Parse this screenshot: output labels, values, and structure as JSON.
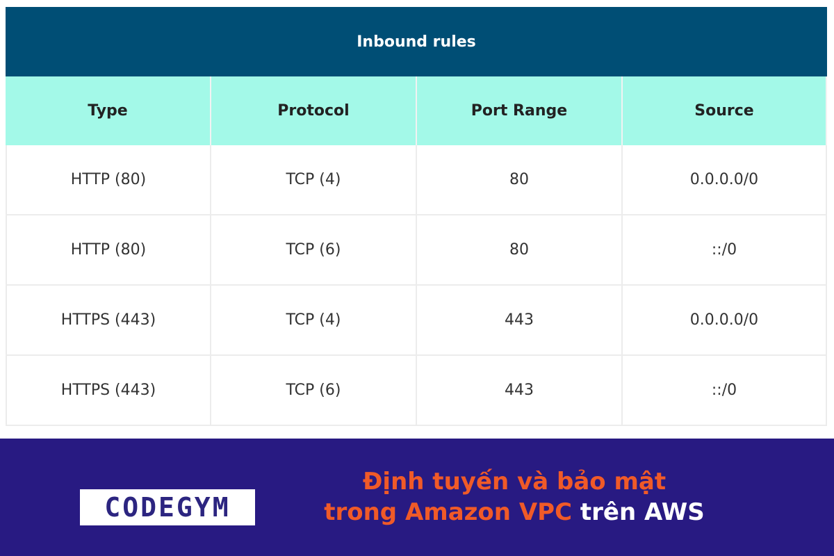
{
  "table": {
    "title": "Inbound rules",
    "columns": [
      "Type",
      "Protocol",
      "Port Range",
      "Source"
    ],
    "rows": [
      [
        "HTTP (80)",
        "TCP (4)",
        "80",
        "0.0.0.0/0"
      ],
      [
        "HTTP (80)",
        "TCP (6)",
        "80",
        "::/0"
      ],
      [
        "HTTPS (443)",
        "TCP (4)",
        "443",
        "0.0.0.0/0"
      ],
      [
        "HTTPS (443)",
        "TCP (6)",
        "443",
        "::/0"
      ]
    ]
  },
  "footer": {
    "logo": "CODEGYM",
    "headline_line1": "Định tuyến và bảo mật",
    "headline_line2_orange": "trong Amazon VPC",
    "headline_line2_white": " trên AWS"
  },
  "colors": {
    "title_bg": "#004e75",
    "header_bg": "#a3f9e8",
    "footer_bg": "#281a82",
    "accent": "#f05a28"
  }
}
